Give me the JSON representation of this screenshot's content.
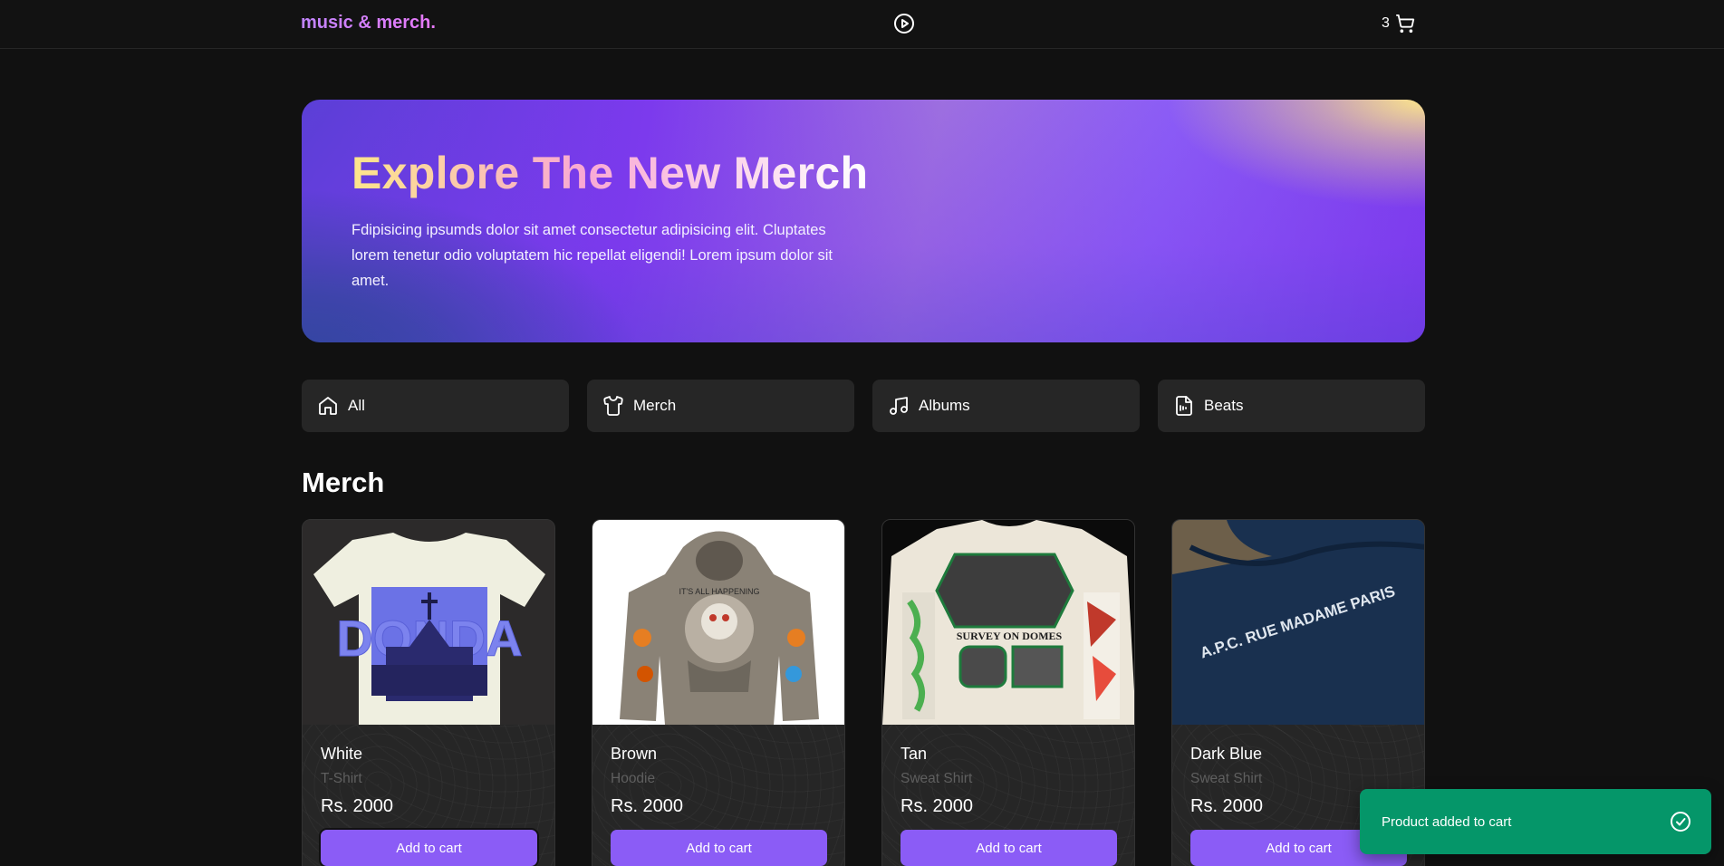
{
  "header": {
    "brand": "music & merch.",
    "cart_count": "3"
  },
  "hero": {
    "title": "Explore The New Merch",
    "text": "Fdipisicing ipsumds dolor sit amet consectetur adipisicing elit. Cluptates lorem tenetur odio voluptatem hic repellat eligendi! Lorem ipsum dolor sit amet."
  },
  "categories": [
    {
      "label": "All",
      "icon": "home-icon"
    },
    {
      "label": "Merch",
      "icon": "tshirt-icon"
    },
    {
      "label": "Albums",
      "icon": "music-note-icon"
    },
    {
      "label": "Beats",
      "icon": "audio-file-icon"
    }
  ],
  "section": {
    "title": "Merch"
  },
  "products": [
    {
      "name": "White",
      "type": "T-Shirt",
      "price": "Rs. 2000",
      "button": "Add to cart",
      "image_text": "DONDA"
    },
    {
      "name": "Brown",
      "type": "Hoodie",
      "price": "Rs. 2000",
      "button": "Add to cart",
      "image_text": "IT'S ALL HAPPENING"
    },
    {
      "name": "Tan",
      "type": "Sweat Shirt",
      "price": "Rs. 2000",
      "button": "Add to cart",
      "image_text": "SURVEY ON DOMES"
    },
    {
      "name": "Dark Blue",
      "type": "Sweat Shirt",
      "price": "Rs. 2000",
      "button": "Add to cart",
      "image_text": "A.P.C. RUE MADAME PARIS"
    }
  ],
  "toast": {
    "message": "Product added to cart"
  },
  "colors": {
    "accent": "#8b5cf6",
    "toast": "#059669",
    "background": "#111111",
    "card": "#262626"
  }
}
